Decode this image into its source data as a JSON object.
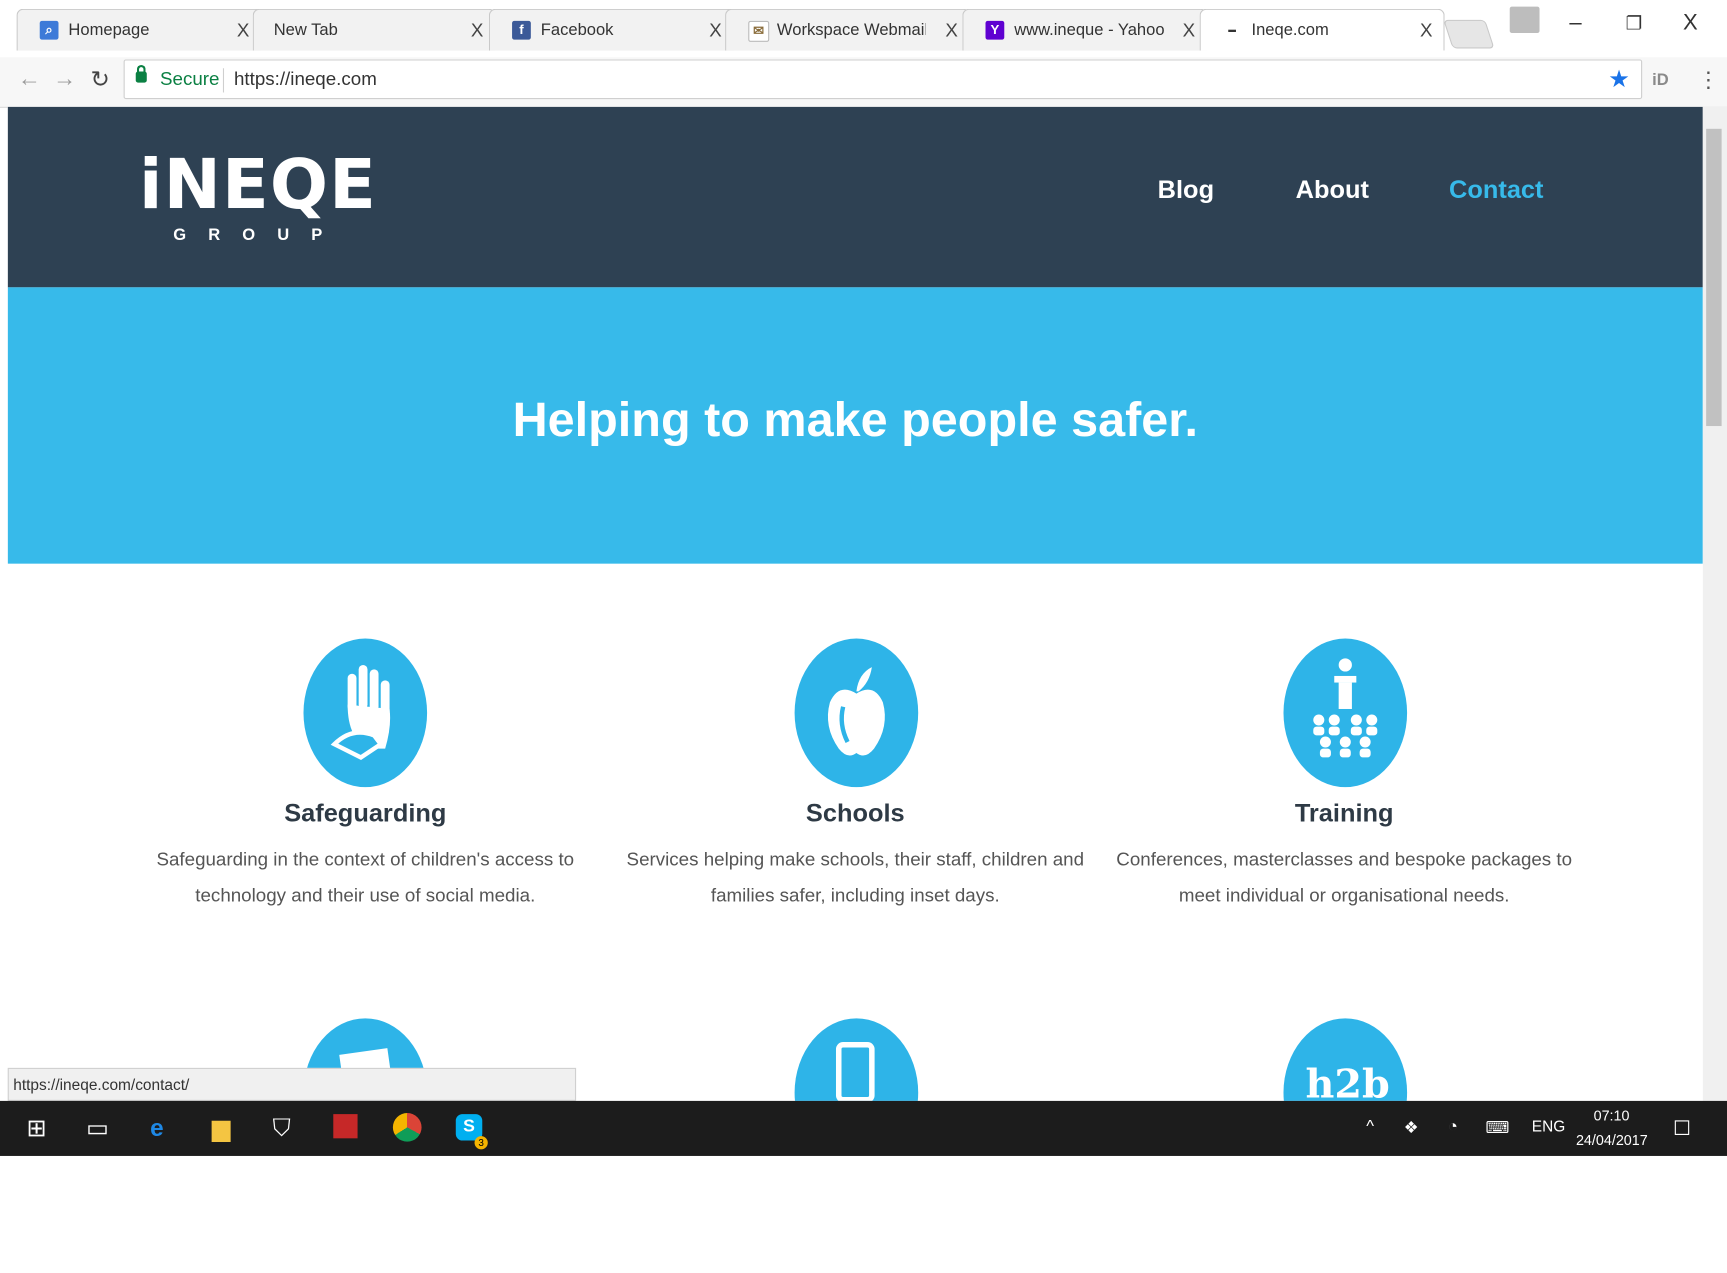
{
  "browser": {
    "tabs": [
      {
        "title": "Homepage",
        "icon": "search-favicon",
        "close": "X"
      },
      {
        "title": "New Tab",
        "icon": "",
        "close": "X"
      },
      {
        "title": "Facebook",
        "icon": "facebook-favicon",
        "close": "X"
      },
      {
        "title": "Workspace Webmail :: M",
        "icon": "webmail-favicon",
        "close": "X"
      },
      {
        "title": "www.ineque - Yahoo Se",
        "icon": "yahoo-favicon",
        "close": "X"
      },
      {
        "title": "Ineqe.com",
        "icon": "ineqe-favicon",
        "close": "X"
      }
    ],
    "window_controls": {
      "minimize": "–",
      "restore": "❐",
      "close": "X"
    },
    "secure_label": "Secure",
    "url": "https://ineqe.com",
    "extension_label": "iD",
    "status_url": "https://ineqe.com/contact/"
  },
  "site": {
    "logo": {
      "main": "iNEQE",
      "sub": "GROUP"
    },
    "nav": [
      "Blog",
      "About",
      "Contact"
    ],
    "active_nav": "Contact",
    "hero_title": "Helping to make people safer.",
    "services": [
      {
        "title": "Safeguarding",
        "desc": "Safeguarding in the context of children's access to technology and their use of social media.",
        "icon": "hand-icon"
      },
      {
        "title": "Schools",
        "desc": "Services helping make schools, their staff, children and families safer, including inset days.",
        "icon": "apple-icon"
      },
      {
        "title": "Training",
        "desc": "Conferences, masterclasses and bespoke packages to meet individual or organisational needs.",
        "icon": "audience-icon"
      }
    ],
    "colors": {
      "header": "#2e4153",
      "hero": "#37baea",
      "accent": "#37baea"
    }
  },
  "taskbar": {
    "language": "ENG",
    "time": "07:10",
    "date": "24/04/2017",
    "skype_badge": "3"
  }
}
